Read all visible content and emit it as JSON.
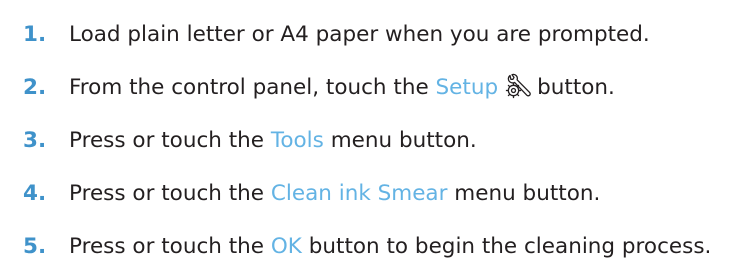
{
  "steps": [
    {
      "number": "1.",
      "text": "Load plain letter or A4 paper when you are prompted."
    },
    {
      "number": "2.",
      "text_before": "From the control panel, touch the",
      "term": "Setup",
      "icon": "setup-wrench-gear-icon",
      "text_after": "button."
    },
    {
      "number": "3.",
      "text_before": "Press or touch the",
      "term": "Tools",
      "text_after": "menu button."
    },
    {
      "number": "4.",
      "text_before": "Press or touch the",
      "term": "Clean ink Smear",
      "text_after": "menu button."
    },
    {
      "number": "5.",
      "text_before": "Press or touch the",
      "term": "OK",
      "text_after": "button to begin the cleaning process."
    }
  ],
  "colors": {
    "step_number": "#3f92ca",
    "ui_term": "#63b3e4",
    "body_text": "#231f20"
  }
}
